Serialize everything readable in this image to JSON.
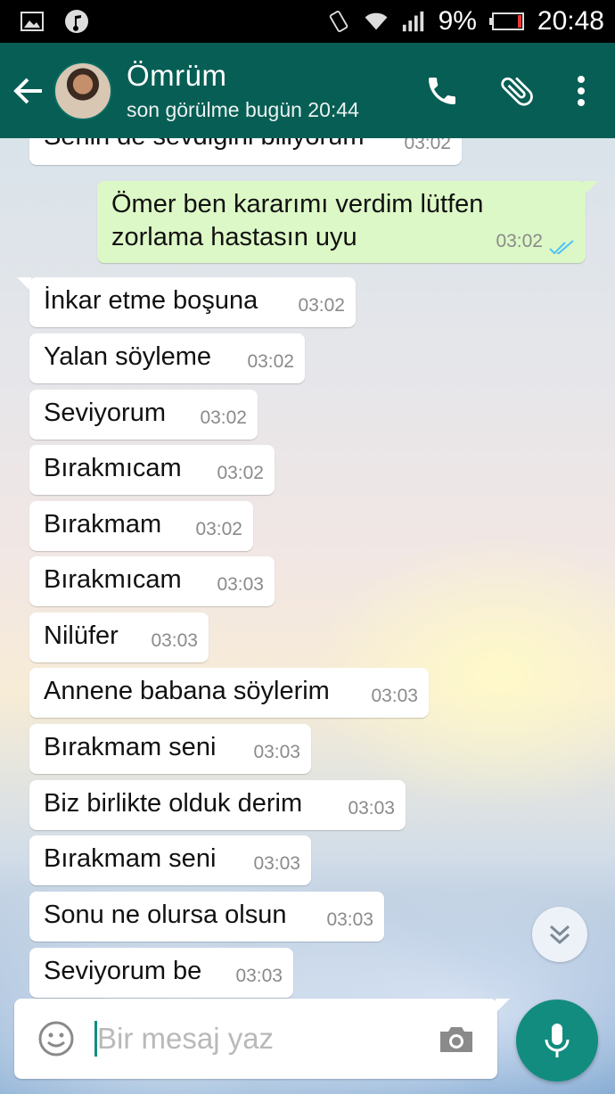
{
  "status_bar": {
    "battery": "9%",
    "time": "20:48",
    "icons": [
      "image-icon",
      "music-icon",
      "vibrate-icon",
      "wifi-icon",
      "signal-icon",
      "battery-icon"
    ]
  },
  "header": {
    "contact_name": "Ömrüm",
    "last_seen": "son görülme bugün 20:44",
    "icons": [
      "back-arrow-icon",
      "phone-icon",
      "paperclip-icon",
      "more-vert-icon"
    ],
    "color": "#075e54"
  },
  "messages": [
    {
      "dir": "in",
      "text": "Senin de sevdiğini biliyorum",
      "time": "03:02"
    },
    {
      "dir": "out",
      "text": "Ömer ben kararımı verdim lütfen zorlama hastasın uyu",
      "time": "03:02",
      "status": "read"
    },
    {
      "dir": "in",
      "text": "İnkar etme boşuna",
      "time": "03:02"
    },
    {
      "dir": "in",
      "text": "Yalan söyleme",
      "time": "03:02"
    },
    {
      "dir": "in",
      "text": "Seviyorum",
      "time": "03:02"
    },
    {
      "dir": "in",
      "text": "Bırakmıcam",
      "time": "03:02"
    },
    {
      "dir": "in",
      "text": "Bırakmam",
      "time": "03:02"
    },
    {
      "dir": "in",
      "text": "Bırakmıcam",
      "time": "03:03"
    },
    {
      "dir": "in",
      "text": "Nilüfer",
      "time": "03:03"
    },
    {
      "dir": "in",
      "text": "Annene babana söylerim",
      "time": "03:03"
    },
    {
      "dir": "in",
      "text": "Bırakmam seni",
      "time": "03:03"
    },
    {
      "dir": "in",
      "text": "Biz birlikte olduk derim",
      "time": "03:03"
    },
    {
      "dir": "in",
      "text": "Bırakmam seni",
      "time": "03:03"
    },
    {
      "dir": "in",
      "text": "Sonu ne olursa olsun",
      "time": "03:03"
    },
    {
      "dir": "in",
      "text": "Seviyorum be",
      "time": "03:03"
    }
  ],
  "composer": {
    "placeholder": "Bir mesaj yaz",
    "value": ""
  },
  "colors": {
    "incoming": "#ffffff",
    "outgoing": "#dcf8c6",
    "accent": "#128c7e",
    "read_ticks": "#4fc3f7"
  }
}
